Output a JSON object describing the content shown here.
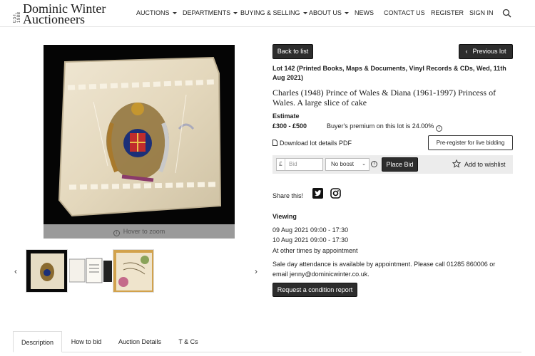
{
  "header": {
    "logo": {
      "established": "EST. 1988",
      "line1": "Dominic Winter",
      "line2": "Auctioneers"
    },
    "nav": [
      {
        "label": "AUCTIONS",
        "dropdown": true
      },
      {
        "label": "DEPARTMENTS",
        "dropdown": true
      },
      {
        "label": "BUYING & SELLING",
        "dropdown": true
      },
      {
        "label": "ABOUT US",
        "dropdown": true
      },
      {
        "label": "NEWS",
        "dropdown": false
      },
      {
        "label": "CONTACT US",
        "dropdown": false
      },
      {
        "label": "REGISTER",
        "dropdown": false
      },
      {
        "label": "SIGN IN",
        "dropdown": false
      }
    ],
    "search_icon": "search-icon"
  },
  "gallery": {
    "hover_text": "Hover to zoom",
    "thumbnails": [
      "cake-slice",
      "invitation-cards",
      "floral-card"
    ]
  },
  "lot": {
    "back_label": "Back to list",
    "previous_label": "Previous lot",
    "title": "Lot 142 (Printed Books, Maps & Documents, Vinyl Records & CDs, Wed, 11th Aug 2021)",
    "description": "Charles (1948) Prince of Wales & Diana (1961-1997) Princess of Wales. A large slice of cake",
    "estimate_label": "Estimate",
    "estimate_value": "£300 - £500",
    "premium_text": "Buyer's premium on this lot is 24.00%",
    "pdf_label": "Download lot details PDF",
    "preregister_label": "Pre-register for live bidding",
    "bid": {
      "currency": "£",
      "placeholder": "Bid",
      "boost_value": "No boost",
      "place_bid_label": "Place Bid",
      "wishlist_label": "Add to wishlist"
    },
    "share_label": "Share this!",
    "viewing": {
      "heading": "Viewing",
      "lines": [
        "09 Aug 2021 09:00 - 17:30",
        "10 Aug 2021 09:00 - 17:30",
        "At other times by appointment"
      ],
      "note_line1": "Sale day attendance is available by appointment. Please call 01285 860006 or",
      "note_line2": "email jenny@dominicwinter.co.uk."
    },
    "condition_label": "Request a condition report"
  },
  "tabs": [
    "Description",
    "How to bid",
    "Auction Details",
    "T & Cs"
  ],
  "colors": {
    "dark_button": "#2d2d2d",
    "bid_row": "#ececec",
    "hover_bar": "#9a9a9a"
  }
}
